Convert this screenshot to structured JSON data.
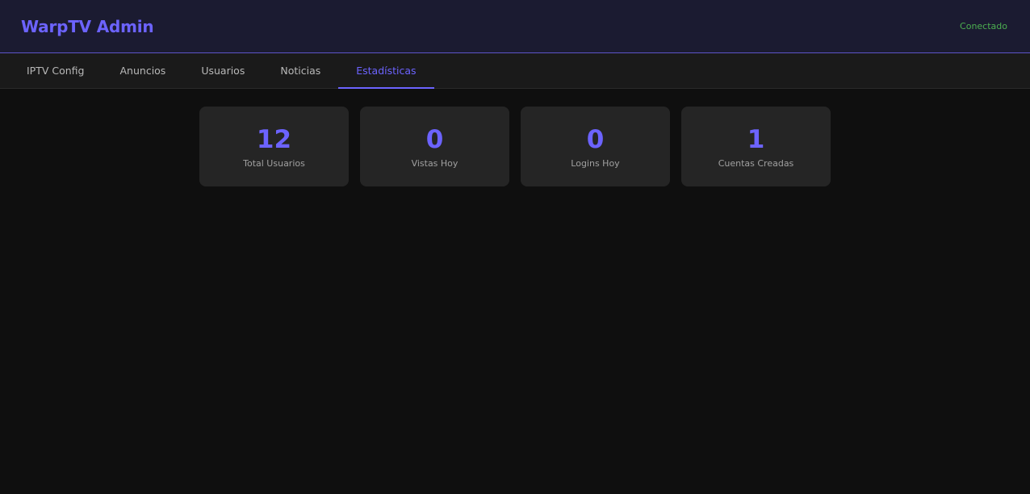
{
  "header": {
    "title": "WarpTV Admin",
    "status": "Conectado"
  },
  "tabs": [
    {
      "label": "IPTV Config",
      "active": false
    },
    {
      "label": "Anuncios",
      "active": false
    },
    {
      "label": "Usuarios",
      "active": false
    },
    {
      "label": "Noticias",
      "active": false
    },
    {
      "label": "Estadísticas",
      "active": true
    }
  ],
  "stats": [
    {
      "value": "12",
      "label": "Total Usuarios"
    },
    {
      "value": "0",
      "label": "Vistas Hoy"
    },
    {
      "value": "0",
      "label": "Logins Hoy"
    },
    {
      "value": "1",
      "label": "Cuentas Creadas"
    }
  ],
  "colors": {
    "accent": "#6c63ff",
    "status_ok": "#4caf50",
    "background": "#0f0f0f",
    "header_bg": "#1b1b31",
    "card_bg": "#252525"
  }
}
